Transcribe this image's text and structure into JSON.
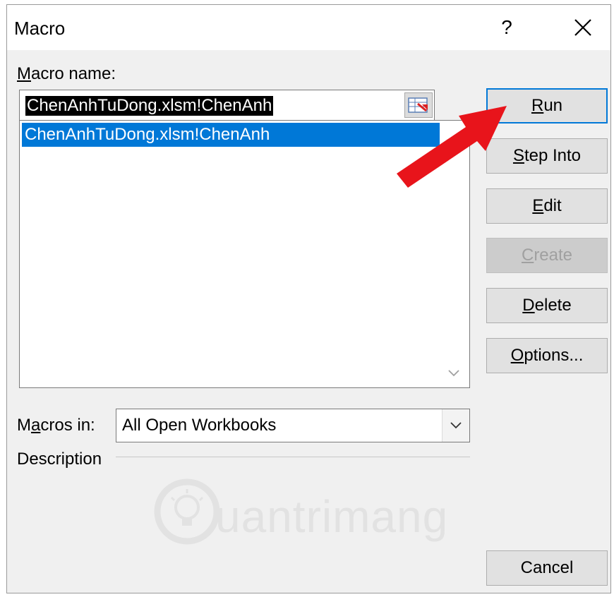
{
  "window": {
    "title": "Macro",
    "help_label": "?",
    "close_label": "✕"
  },
  "macro_name": {
    "label_underlined": "M",
    "label_rest": "acro name:",
    "value": "ChenAnhTuDong.xlsm!ChenAnh",
    "ref_button_icon": "range-select-icon"
  },
  "macro_list": {
    "items": [
      "ChenAnhTuDong.xlsm!ChenAnh"
    ],
    "selected_index": 0
  },
  "buttons": [
    {
      "pre": "",
      "u": "R",
      "post": "un",
      "state": "default"
    },
    {
      "pre": "",
      "u": "S",
      "post": "tep Into",
      "state": "enabled"
    },
    {
      "pre": "",
      "u": "E",
      "post": "dit",
      "state": "enabled"
    },
    {
      "pre": "",
      "u": "C",
      "post": "reate",
      "state": "disabled"
    },
    {
      "pre": "",
      "u": "D",
      "post": "elete",
      "state": "enabled"
    },
    {
      "pre": "",
      "u": "O",
      "post": "ptions...",
      "state": "enabled"
    },
    {
      "pre": "",
      "u": "",
      "post": "Cancel",
      "state": "enabled"
    }
  ],
  "macros_in": {
    "label_pre": "M",
    "label_underlined": "a",
    "label_post": "cros in:",
    "value": "All Open Workbooks",
    "dropdown_icon": "chevron-down-icon"
  },
  "description": {
    "label": "Description"
  },
  "overlay": {
    "arrow_icon": "red-arrow-icon",
    "watermark_icon": "lightbulb-logo-icon",
    "watermark_text": "uantrimang"
  },
  "colors": {
    "selection": "#0078d7",
    "arrow": "#e8141b",
    "dialog_bg": "#f0f0f0"
  }
}
